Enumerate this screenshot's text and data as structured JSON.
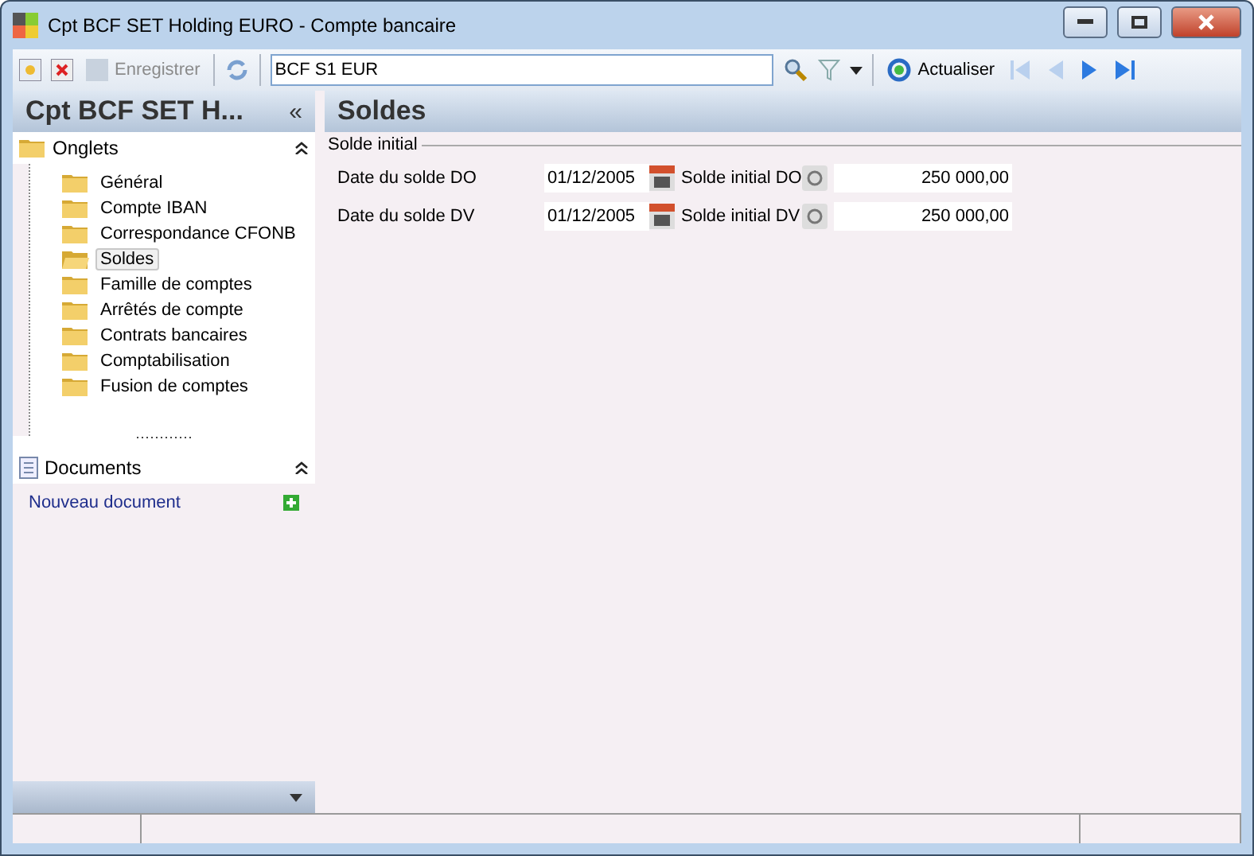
{
  "window": {
    "title": "Cpt BCF SET Holding EURO -  Compte bancaire"
  },
  "toolbar": {
    "save": {
      "label": "Enregistrer",
      "disabled": true
    },
    "search": {
      "value": "BCF S1 EUR"
    },
    "refresh": {
      "label": "Actualiser"
    },
    "nav": [
      {
        "kind": "first",
        "disabled": true
      },
      {
        "kind": "prev",
        "disabled": true
      },
      {
        "kind": "next",
        "disabled": false
      },
      {
        "kind": "last",
        "disabled": false
      }
    ]
  },
  "sidebar": {
    "title": "Cpt BCF SET H...",
    "collapse": "«",
    "tabs_header": "Onglets",
    "tabs": [
      {
        "label": "Général",
        "selected": false
      },
      {
        "label": "Compte IBAN",
        "selected": false
      },
      {
        "label": "Correspondance CFONB",
        "selected": false
      },
      {
        "label": "Soldes",
        "selected": true
      },
      {
        "label": "Famille de comptes",
        "selected": false
      },
      {
        "label": "Arrêtés de compte",
        "selected": false
      },
      {
        "label": "Contrats bancaires",
        "selected": false
      },
      {
        "label": "Comptabilisation",
        "selected": false
      },
      {
        "label": "Fusion de comptes",
        "selected": false
      }
    ],
    "documents_header": "Documents",
    "new_document": "Nouveau document"
  },
  "main": {
    "title": "Soldes",
    "group": "Solde initial",
    "rows": [
      {
        "date_label": "Date du solde DO",
        "date": "01/12/2005",
        "amount_label": "Solde initial DO",
        "amount": "250 000,00"
      },
      {
        "date_label": "Date du solde DV",
        "date": "01/12/2005",
        "amount_label": "Solde initial DV",
        "amount": "250 000,00"
      }
    ]
  }
}
